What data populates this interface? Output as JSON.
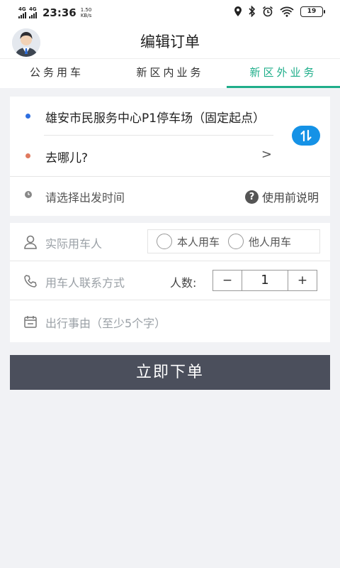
{
  "status_bar": {
    "net1": "4G",
    "net2": "4G",
    "time": "23:36",
    "speed_value": "1.50",
    "speed_unit": "KB/s",
    "battery": "19"
  },
  "header": {
    "title": "编辑订单",
    "avatar_icon": "user-avatar-icon"
  },
  "tabs": [
    {
      "label": "公务用车",
      "active": false
    },
    {
      "label": "新区内业务",
      "active": false
    },
    {
      "label": "新区外业务",
      "active": true
    }
  ],
  "location": {
    "start": "雄安市民服务中心P1停车场（固定起点）",
    "destination_placeholder": "去哪儿?",
    "chevron": ">",
    "time_placeholder": "请选择出发时间",
    "help_label": "使用前说明",
    "help_glyph": "?",
    "start_dot_color": "#2f6fe0",
    "dest_dot_color": "#e07a5f",
    "swap_color": "#1592e6"
  },
  "form": {
    "passenger_label": "实际用车人",
    "radio_self": "本人用车",
    "radio_other": "他人用车",
    "contact_label": "用车人联系方式",
    "people_label": "人数:",
    "stepper_minus": "−",
    "stepper_value": "1",
    "stepper_plus": "+",
    "reason_label": "出行事由（至少5个字）"
  },
  "submit": {
    "label": "立即下单",
    "color": "#4b4f5c"
  },
  "accent_color": "#1fae8a"
}
